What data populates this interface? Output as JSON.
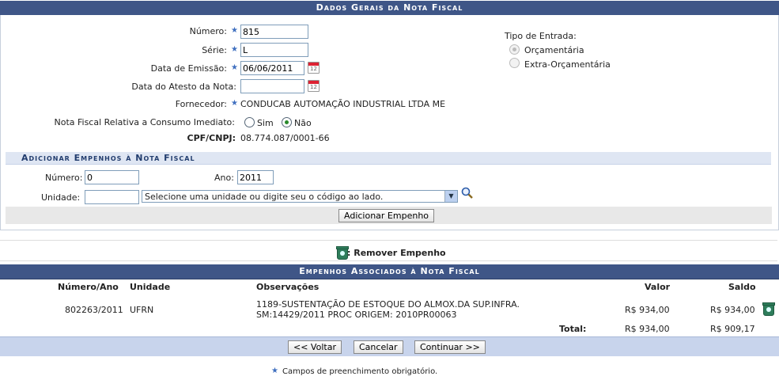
{
  "form": {
    "title": "Dados Gerais da Nota Fiscal",
    "numero_label": "Número:",
    "numero_value": "815",
    "serie_label": "Série:",
    "serie_value": "L",
    "data_emissao_label": "Data de Emissão:",
    "data_emissao_value": "06/06/2011",
    "data_atesto_label": "Data do Atesto da Nota:",
    "data_atesto_value": "",
    "fornecedor_label": "Fornecedor:",
    "fornecedor_value": "CONDUCAB AUTOMAÇÃO INDUSTRIAL LTDA ME",
    "consumo_label": "Nota Fiscal Relativa a Consumo Imediato:",
    "consumo_options": [
      "Sim",
      "Não"
    ],
    "consumo_selected": "Não",
    "cpf_label": "CPF/CNPJ:",
    "cpf_value": "08.774.087/0001-66",
    "tipo_entrada_label": "Tipo de Entrada:",
    "tipo_entrada_options": [
      "Orçamentária",
      "Extra-Orçamentária"
    ],
    "tipo_entrada_selected": "Orçamentária"
  },
  "empenho": {
    "title": "Adicionar Empenhos à Nota Fiscal",
    "numero_label": "Número:",
    "numero_value": "0",
    "ano_label": "Ano:",
    "ano_value": "2011",
    "unidade_label": "Unidade:",
    "unidade_value": "",
    "unidade_select": "Selecione uma unidade ou digite seu o código ao lado.",
    "add_button": "Adicionar Empenho"
  },
  "legend": {
    "remover": ": Remover Empenho"
  },
  "table": {
    "title": "Empenhos Associados à Nota Fiscal",
    "headers": [
      "Número/Ano",
      "Unidade",
      "Observações",
      "Valor",
      "Saldo"
    ],
    "rows": [
      {
        "numero_ano": "802263/2011",
        "unidade": "UFRN",
        "obs_line1": "1189-SUSTENTAÇÃO DE ESTOQUE DO ALMOX.DA SUP.INFRA.",
        "obs_line2": "SM:14429/2011 PROC ORIGEM: 2010PR00063",
        "valor": "R$ 934,00",
        "saldo": "R$ 934,00"
      }
    ],
    "total_label": "Total:",
    "total_valor": "R$ 934,00",
    "total_saldo": "R$ 909,17"
  },
  "actions": {
    "voltar": "<< Voltar",
    "cancelar": "Cancelar",
    "continuar": "Continuar >>"
  },
  "footer": {
    "required_note": "Campos de preenchimento obrigatório."
  }
}
